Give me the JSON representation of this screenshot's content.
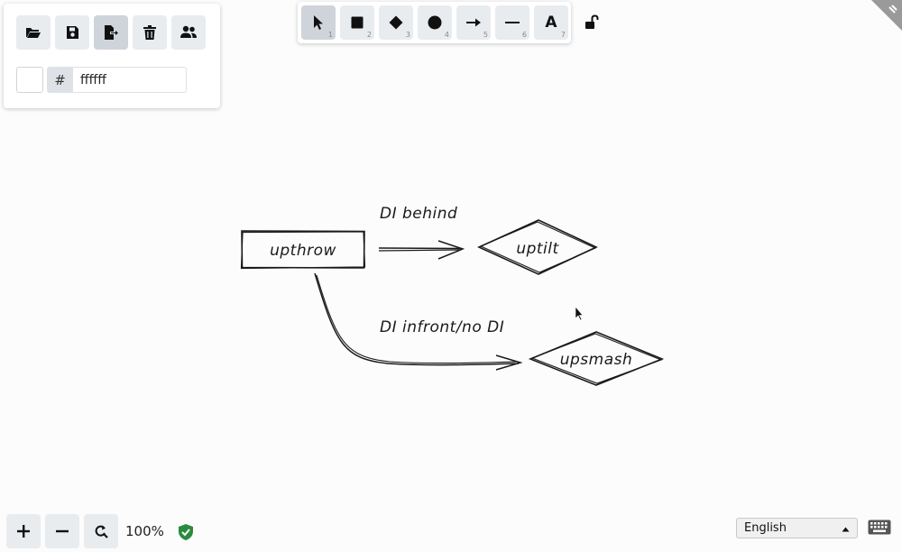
{
  "menu": {
    "buttons": [
      {
        "name": "open-button",
        "icon": "folder-open-icon"
      },
      {
        "name": "save-button",
        "icon": "floppy-disk-icon"
      },
      {
        "name": "export-button",
        "icon": "file-export-icon"
      },
      {
        "name": "clear-canvas-button",
        "icon": "trash-icon"
      },
      {
        "name": "collaboration-button",
        "icon": "users-icon"
      }
    ],
    "background_color": {
      "hash_label": "#",
      "value": "ffffff",
      "swatch": "#ffffff"
    }
  },
  "toolbar": {
    "tools": [
      {
        "name": "selection",
        "shortcut": "1",
        "icon": "cursor-arrow-icon"
      },
      {
        "name": "rectangle",
        "shortcut": "2",
        "icon": "square-icon"
      },
      {
        "name": "diamond",
        "shortcut": "3",
        "icon": "diamond-icon"
      },
      {
        "name": "ellipse",
        "shortcut": "4",
        "icon": "circle-icon"
      },
      {
        "name": "arrow",
        "shortcut": "5",
        "icon": "arrow-right-icon"
      },
      {
        "name": "line",
        "shortcut": "6",
        "icon": "line-icon"
      },
      {
        "name": "text",
        "shortcut": "7",
        "icon": "letter-a-icon",
        "glyph": "A"
      }
    ],
    "lock_icon": "unlock-icon"
  },
  "canvas": {
    "shapes": {
      "upthrow": "upthrow",
      "uptilt": "uptilt",
      "upsmash": "upsmash"
    },
    "labels": {
      "arrow1": "DI behind",
      "arrow2": "DI infront/no DI"
    },
    "stroke_color": "#1a1a1a"
  },
  "footer": {
    "zoom_in_icon": "plus-icon",
    "zoom_out_icon": "minus-icon",
    "reset_zoom_icon": "reset-zoom-icon",
    "zoom_level": "100%",
    "encryption_icon": "shield-check-icon",
    "shield_color": "#2b8a3e",
    "language": "English",
    "keyboard_icon": "keyboard-icon"
  },
  "colors": {
    "button_bg": "#e9ecef",
    "button_active": "#ced4da",
    "canvas_bg": "#fcfcfc"
  }
}
